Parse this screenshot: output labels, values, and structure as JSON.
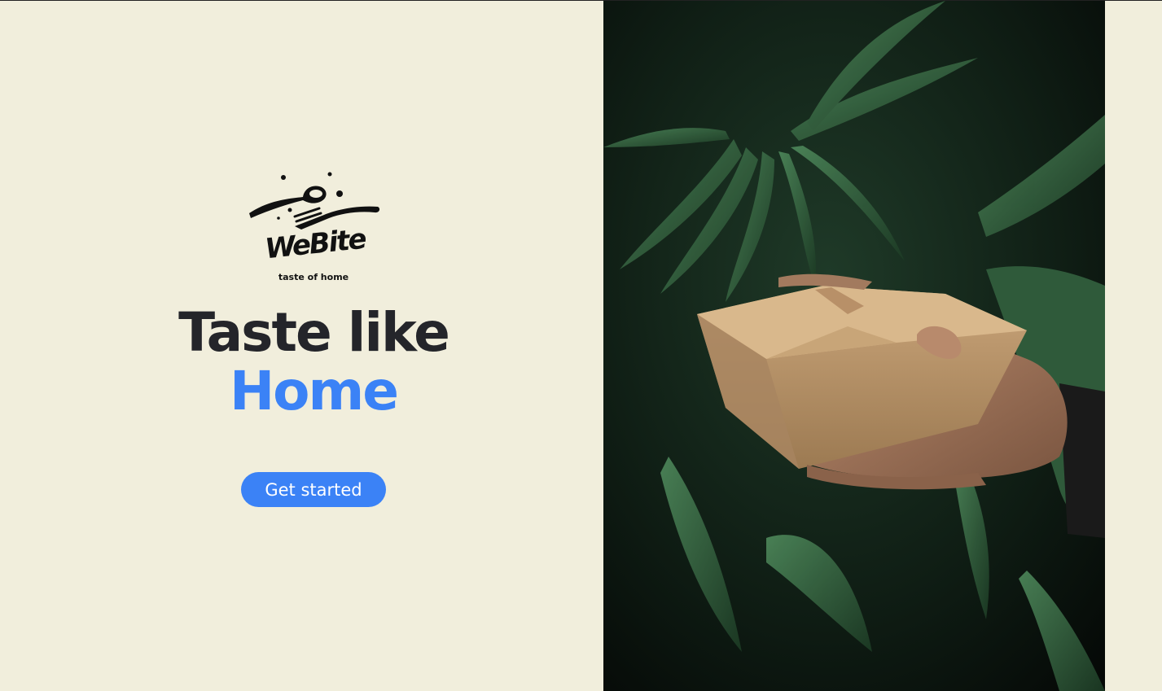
{
  "brand": {
    "logo_name": "WeBite",
    "tagline": "taste of home"
  },
  "hero": {
    "headline_line1": "Taste like",
    "headline_line2": "Home",
    "cta_label": "Get started",
    "accent_color": "#3b82f6",
    "text_color": "#24252a",
    "background_color": "#f1eedc"
  },
  "photo": {
    "subject": "hand-holding-takeaway-box"
  }
}
